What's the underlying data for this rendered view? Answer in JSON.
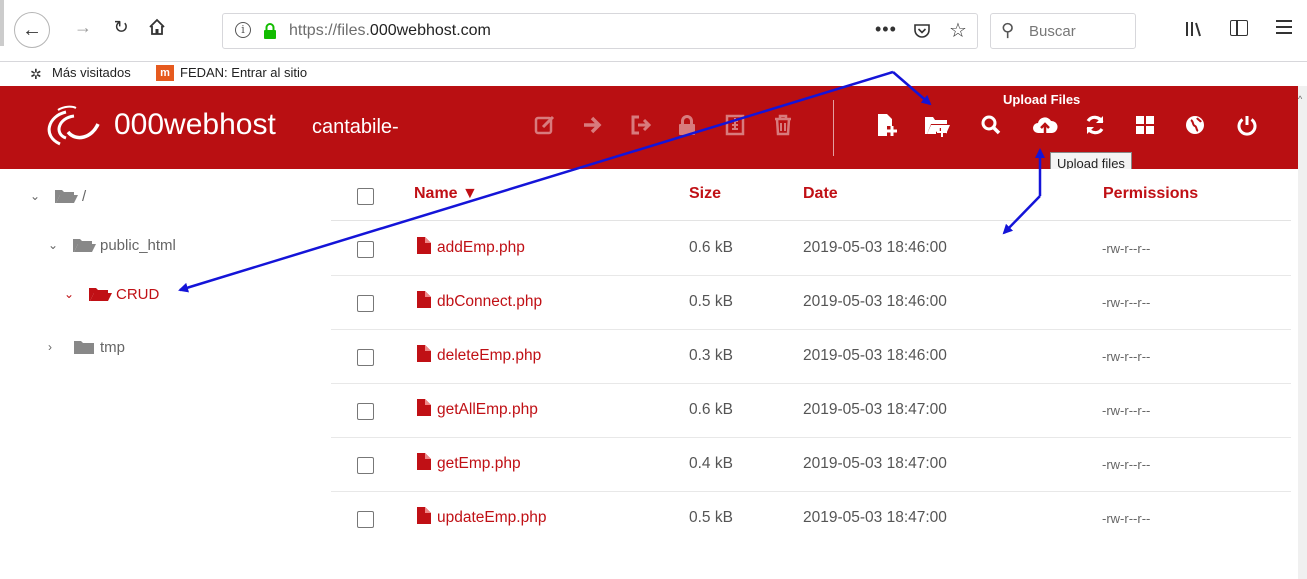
{
  "browser": {
    "url_prefix": "https://files.",
    "url_host": "000webhost.com",
    "search_placeholder": "Buscar",
    "bookmarks": [
      {
        "label": "Más visitados"
      },
      {
        "label": "FEDAN: Entrar al sitio",
        "icon_letter": "m"
      }
    ]
  },
  "header": {
    "brand": "000webhost",
    "site": "cantabile-",
    "upload_label": "Upload Files",
    "tooltip": "Upload files",
    "colors": {
      "brand": "#b90f12",
      "accent": "#c01015"
    }
  },
  "tree": {
    "items": [
      {
        "label": "/",
        "chevron": "chevron-down-icon"
      },
      {
        "label": "public_html",
        "chevron": "chevron-down-icon"
      },
      {
        "label": "CRUD",
        "chevron": "chevron-down-icon",
        "active": true
      },
      {
        "label": "tmp",
        "chevron": "chevron-right-icon"
      }
    ]
  },
  "table": {
    "headers": {
      "name": "Name ▼",
      "size": "Size",
      "date": "Date",
      "permissions": "Permissions"
    },
    "rows": [
      {
        "name": "addEmp.php",
        "size": "0.6 kB",
        "date": "2019-05-03 18:46:00",
        "perm": "-rw-r--r--"
      },
      {
        "name": "dbConnect.php",
        "size": "0.5 kB",
        "date": "2019-05-03 18:46:00",
        "perm": "-rw-r--r--"
      },
      {
        "name": "deleteEmp.php",
        "size": "0.3 kB",
        "date": "2019-05-03 18:46:00",
        "perm": "-rw-r--r--"
      },
      {
        "name": "getAllEmp.php",
        "size": "0.6 kB",
        "date": "2019-05-03 18:47:00",
        "perm": "-rw-r--r--"
      },
      {
        "name": "getEmp.php",
        "size": "0.4 kB",
        "date": "2019-05-03 18:47:00",
        "perm": "-rw-r--r--"
      },
      {
        "name": "updateEmp.php",
        "size": "0.5 kB",
        "date": "2019-05-03 18:47:00",
        "perm": "-rw-r--r--"
      }
    ]
  }
}
